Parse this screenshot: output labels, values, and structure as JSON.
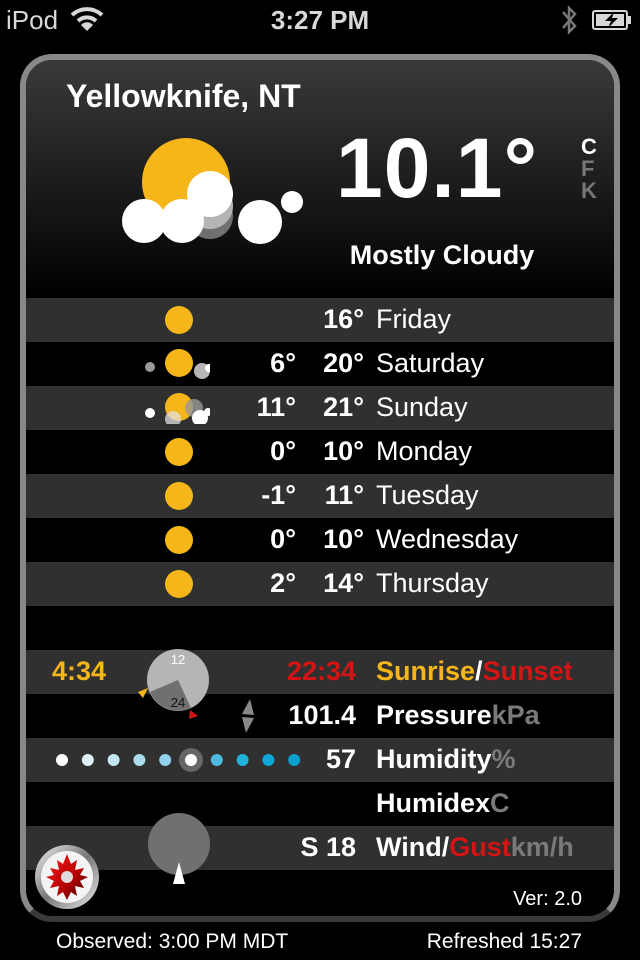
{
  "status_bar": {
    "carrier": "iPod",
    "time": "3:27 PM",
    "icons": [
      "wifi-icon",
      "bluetooth-icon",
      "battery-charging-icon"
    ]
  },
  "current": {
    "city": "Yellowknife, NT",
    "temperature": "10.1°",
    "condition": "Mostly Cloudy",
    "icon": "sun-behind-clouds-icon",
    "units": [
      {
        "label": "C",
        "active": true
      },
      {
        "label": "F",
        "active": false
      },
      {
        "label": "K",
        "active": false
      }
    ]
  },
  "forecast": [
    {
      "day": "Friday",
      "low": "",
      "high": "16°",
      "icon": "sunny"
    },
    {
      "day": "Saturday",
      "low": "6°",
      "high": "20°",
      "icon": "sun-few-clouds"
    },
    {
      "day": "Sunday",
      "low": "11°",
      "high": "21°",
      "icon": "sun-clouds"
    },
    {
      "day": "Monday",
      "low": "0°",
      "high": "10°",
      "icon": "sunny"
    },
    {
      "day": "Tuesday",
      "low": "-1°",
      "high": "11°",
      "icon": "sunny"
    },
    {
      "day": "Wednesday",
      "low": "0°",
      "high": "10°",
      "icon": "sunny"
    },
    {
      "day": "Thursday",
      "low": "2°",
      "high": "14°",
      "icon": "sunny"
    }
  ],
  "details": {
    "sun": {
      "sunrise": "4:34",
      "sunset": "22:34",
      "label_sunrise": "Sunrise",
      "label_sep": "/",
      "label_sunset": "Sunset",
      "clock_top": "12",
      "clock_bottom": "24"
    },
    "pressure": {
      "value": "101.4",
      "label": "Pressure",
      "unit": "kPa",
      "trend": "steady"
    },
    "humidity": {
      "value": "57",
      "label": "Humidity",
      "unit": "%",
      "scale_steps": 10,
      "selected_step": 6
    },
    "humidex": {
      "value": "",
      "label": "Humidex",
      "unit": "C"
    },
    "wind": {
      "value": "S 18",
      "label": "Wind",
      "sep": "/",
      "gust_label": "Gust",
      "unit": "km/h",
      "direction": "S"
    }
  },
  "footer": {
    "version": "Ver: 2.0",
    "observed": "Observed: 3:00 PM MDT",
    "refreshed": "Refreshed 15:27"
  },
  "colors": {
    "sun": "#f6b519",
    "sunset": "#d41414",
    "row_alt": "#303030"
  }
}
